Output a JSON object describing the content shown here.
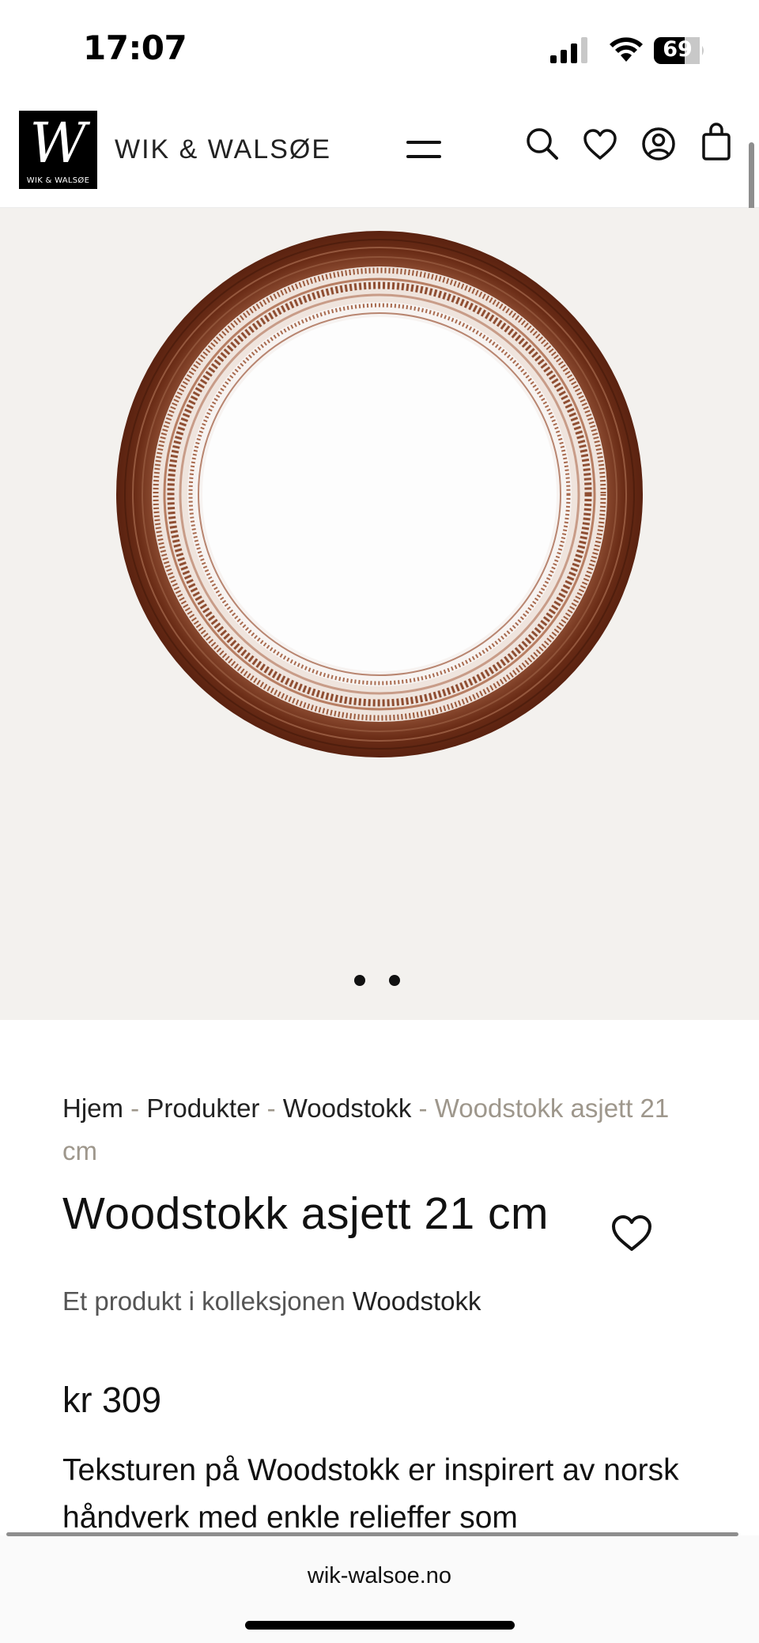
{
  "status_bar": {
    "time": "17:07",
    "battery_level": "69",
    "icons": [
      "signal-icon",
      "wifi-icon",
      "battery-icon"
    ]
  },
  "header": {
    "logo_letter": "W",
    "logo_subtext": "WIK & WALSØE",
    "brand_name": "WIK & WALSØE",
    "icons": [
      "menu-icon",
      "search-icon",
      "heart-icon",
      "account-icon",
      "cart-icon"
    ]
  },
  "gallery": {
    "slide_count": 2,
    "active_slide": 1
  },
  "breadcrumb": {
    "items": [
      "Hjem",
      "Produkter",
      "Woodstokk"
    ],
    "separator": " - ",
    "current": "Woodstokk asjett 21 cm"
  },
  "product": {
    "title": "Woodstokk asjett 21 cm",
    "collection_prefix": "Et produkt i kolleksjonen",
    "collection_name": "Woodstokk",
    "price": "kr 309",
    "description": "Teksturen på Woodstokk er inspirert av norsk håndverk med enkle relieffer som"
  },
  "browser": {
    "url": "wik-walsoe.no"
  },
  "colors": {
    "accent_brown": "#7a3a22",
    "gallery_bg": "#f3f1ee",
    "muted_text": "#9e978c"
  }
}
